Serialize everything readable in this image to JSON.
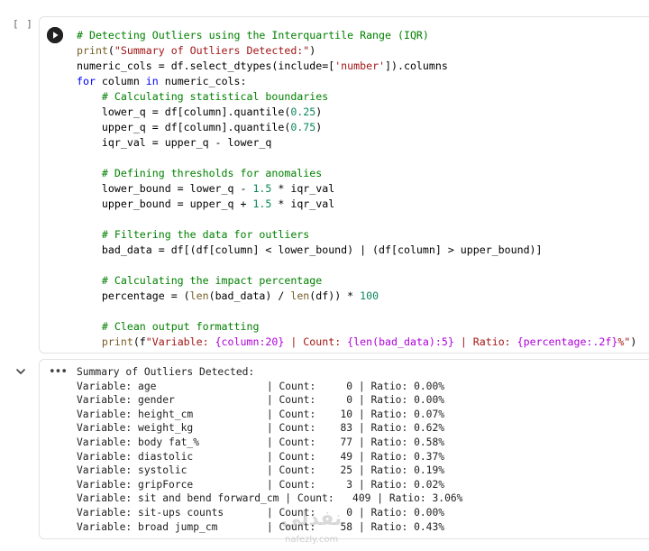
{
  "cell": {
    "execution_count": "[ ]",
    "code_lines": [
      [
        {
          "t": "# Detecting Outliers using the Interquartile Range (IQR)",
          "c": "cm"
        }
      ],
      [
        {
          "t": "print",
          "c": "fn"
        },
        {
          "t": "(",
          "c": ""
        },
        {
          "t": "\"Summary of Outliers Detected:\"",
          "c": "str"
        },
        {
          "t": ")",
          "c": ""
        }
      ],
      [
        {
          "t": "numeric_cols = df.select_dtypes(include=[",
          "c": ""
        },
        {
          "t": "'number'",
          "c": "str"
        },
        {
          "t": "]).columns",
          "c": ""
        }
      ],
      [
        {
          "t": "for",
          "c": "kw"
        },
        {
          "t": " column ",
          "c": ""
        },
        {
          "t": "in",
          "c": "kw"
        },
        {
          "t": " numeric_cols:",
          "c": ""
        }
      ],
      [
        {
          "t": "    ",
          "c": ""
        },
        {
          "t": "# Calculating statistical boundaries",
          "c": "cm"
        }
      ],
      [
        {
          "t": "    lower_q = df[column].quantile(",
          "c": ""
        },
        {
          "t": "0.25",
          "c": "num"
        },
        {
          "t": ")",
          "c": ""
        }
      ],
      [
        {
          "t": "    upper_q = df[column].quantile(",
          "c": ""
        },
        {
          "t": "0.75",
          "c": "num"
        },
        {
          "t": ")",
          "c": ""
        }
      ],
      [
        {
          "t": "    iqr_val = upper_q - lower_q",
          "c": ""
        }
      ],
      [
        {
          "t": "",
          "c": ""
        }
      ],
      [
        {
          "t": "    ",
          "c": ""
        },
        {
          "t": "# Defining thresholds for anomalies",
          "c": "cm"
        }
      ],
      [
        {
          "t": "    lower_bound = lower_q - ",
          "c": ""
        },
        {
          "t": "1.5",
          "c": "num"
        },
        {
          "t": " * iqr_val",
          "c": ""
        }
      ],
      [
        {
          "t": "    upper_bound = upper_q + ",
          "c": ""
        },
        {
          "t": "1.5",
          "c": "num"
        },
        {
          "t": " * iqr_val",
          "c": ""
        }
      ],
      [
        {
          "t": "",
          "c": ""
        }
      ],
      [
        {
          "t": "    ",
          "c": ""
        },
        {
          "t": "# Filtering the data for outliers",
          "c": "cm"
        }
      ],
      [
        {
          "t": "    bad_data = df[(df[column] < lower_bound) | (df[column] > upper_bound)]",
          "c": ""
        }
      ],
      [
        {
          "t": "",
          "c": ""
        }
      ],
      [
        {
          "t": "    ",
          "c": ""
        },
        {
          "t": "# Calculating the impact percentage",
          "c": "cm"
        }
      ],
      [
        {
          "t": "    percentage = (",
          "c": ""
        },
        {
          "t": "len",
          "c": "fn"
        },
        {
          "t": "(bad_data) / ",
          "c": ""
        },
        {
          "t": "len",
          "c": "fn"
        },
        {
          "t": "(df)) * ",
          "c": ""
        },
        {
          "t": "100",
          "c": "num"
        }
      ],
      [
        {
          "t": "",
          "c": ""
        }
      ],
      [
        {
          "t": "    ",
          "c": ""
        },
        {
          "t": "# Clean output formatting",
          "c": "cm"
        }
      ],
      [
        {
          "t": "    ",
          "c": ""
        },
        {
          "t": "print",
          "c": "fn"
        },
        {
          "t": "(f",
          "c": ""
        },
        {
          "t": "\"Variable: ",
          "c": "str"
        },
        {
          "t": "{column:20}",
          "c": "op"
        },
        {
          "t": " | Count: ",
          "c": "str"
        },
        {
          "t": "{len(bad_data):5}",
          "c": "op"
        },
        {
          "t": " | Ratio: ",
          "c": "str"
        },
        {
          "t": "{percentage:.2f}",
          "c": "op"
        },
        {
          "t": "%\"",
          "c": "str"
        },
        {
          "t": ")",
          "c": ""
        }
      ]
    ]
  },
  "output": {
    "more_label": "•••",
    "lines": [
      "Summary of Outliers Detected:",
      "Variable: age                  | Count:     0 | Ratio: 0.00%",
      "Variable: gender               | Count:     0 | Ratio: 0.00%",
      "Variable: height_cm            | Count:    10 | Ratio: 0.07%",
      "Variable: weight_kg            | Count:    83 | Ratio: 0.62%",
      "Variable: body fat_%           | Count:    77 | Ratio: 0.58%",
      "Variable: diastolic            | Count:    49 | Ratio: 0.37%",
      "Variable: systolic             | Count:    25 | Ratio: 0.19%",
      "Variable: gripForce            | Count:     3 | Ratio: 0.02%",
      "Variable: sit and bend forward_cm | Count:   409 | Ratio: 3.06%",
      "Variable: sit-ups counts       | Count:     0 | Ratio: 0.00%",
      "Variable: broad jump_cm        | Count:    58 | Ratio: 0.43%"
    ]
  },
  "watermark": {
    "logo_text": "نفذلي",
    "url_text": "nafezly.com"
  },
  "icons": {
    "run": "play-circle-icon",
    "collapse": "chevron-down-icon",
    "more": "more-horizontal-icon"
  }
}
